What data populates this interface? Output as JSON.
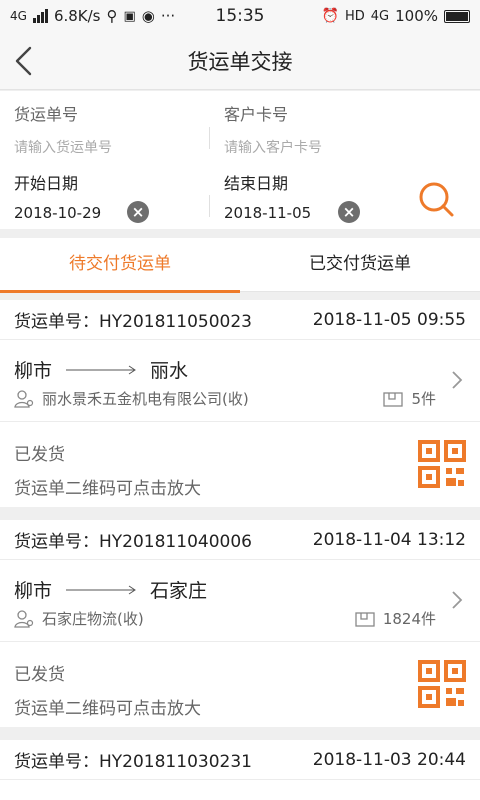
{
  "status_bar": {
    "network_left": "4G",
    "speed": "6.8K/s",
    "time": "15:35",
    "hd": "HD",
    "network_right": "4G",
    "battery": "100%"
  },
  "nav": {
    "title": "货运单交接"
  },
  "filter": {
    "waybill_label": "货运单号",
    "waybill_placeholder": "请输入货运单号",
    "card_label": "客户卡号",
    "card_placeholder": "请输入客户卡号",
    "start_label": "开始日期",
    "start_date": "2018-10-29",
    "end_label": "结束日期",
    "end_date": "2018-11-05"
  },
  "tabs": [
    {
      "label": "待交付货运单",
      "active": true
    },
    {
      "label": "已交付货运单",
      "active": false
    }
  ],
  "accent_color": "#ee7a2a",
  "orders": [
    {
      "waybill_no": "货运单号：HY201811050023",
      "datetime": "2018-11-05 09:55",
      "origin": "柳市",
      "destination": "丽水",
      "company": "丽水景禾五金机电有限公司(收)",
      "pieces": "5件",
      "status": "已发货",
      "qr_hint": "货运单二维码可点击放大"
    },
    {
      "waybill_no": "货运单号：HY201811040006",
      "datetime": "2018-11-04 13:12",
      "origin": "柳市",
      "destination": "石家庄",
      "company": "石家庄物流(收)",
      "pieces": "1824件",
      "status": "已发货",
      "qr_hint": "货运单二维码可点击放大"
    },
    {
      "waybill_no": "货运单号：HY201811030231",
      "datetime": "2018-11-03 20:44"
    }
  ]
}
